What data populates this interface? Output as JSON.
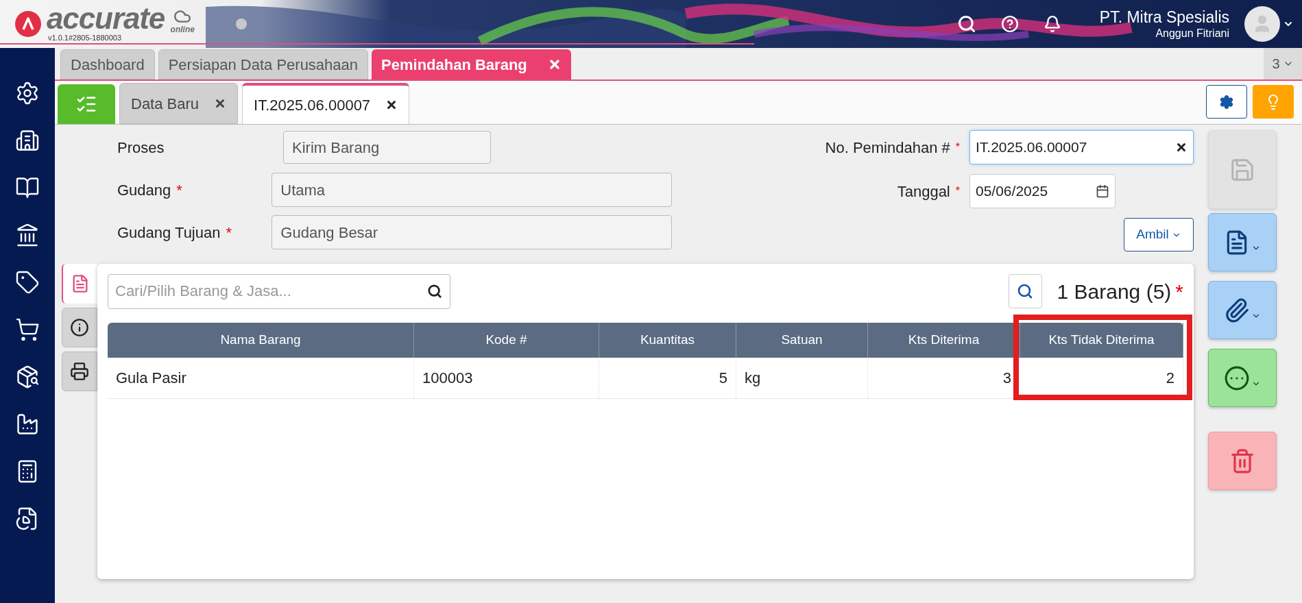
{
  "app": {
    "logo_text": "accurate",
    "logo_sub": "online",
    "version": "v1.0.1#2805-1880003"
  },
  "header": {
    "company": "PT. Mitra Spesialis",
    "user": "Anggun Fitriani"
  },
  "main_tabs": [
    {
      "label": "Dashboard",
      "selected": false,
      "closable": false
    },
    {
      "label": "Persiapan Data Perusahaan",
      "selected": false,
      "closable": false
    },
    {
      "label": "Pemindahan Barang",
      "selected": true,
      "closable": true
    }
  ],
  "tab_count": "3",
  "sub_tabs": [
    {
      "label": "Data Baru",
      "selected": false
    },
    {
      "label": "IT.2025.06.00007",
      "selected": true
    }
  ],
  "form": {
    "left": [
      {
        "label": "Proses",
        "value": "Kirim Barang"
      },
      {
        "label": "Gudang",
        "required_mark": "*",
        "value": "Utama"
      },
      {
        "label": "Gudang Tujuan",
        "required_mark": "*",
        "value": "Gudang Besar"
      }
    ],
    "number": {
      "label": "No. Pemindahan #",
      "required_mark": "*",
      "value": "IT.2025.06.00007"
    },
    "date": {
      "label": "Tanggal",
      "required_mark": "*",
      "value": "05/06/2025"
    },
    "fetch_button": "Ambil"
  },
  "side_tabs": [
    {
      "kind": "detail",
      "selected": true
    },
    {
      "kind": "info",
      "selected": false
    },
    {
      "kind": "print",
      "selected": false
    }
  ],
  "items": {
    "search_placeholder": "Cari/Pilih Barang & Jasa...",
    "count": "1 Barang (5)",
    "required_mark": "*",
    "columns": [
      {
        "label": "Nama Barang",
        "kind": "text",
        "highlighted": false
      },
      {
        "label": "Kode #",
        "kind": "text",
        "highlighted": false
      },
      {
        "label": "Kuantitas",
        "kind": "number",
        "highlighted": false
      },
      {
        "label": "Satuan",
        "kind": "text",
        "highlighted": false
      },
      {
        "label": "Kts Diterima",
        "kind": "number",
        "highlighted": false
      },
      {
        "label": "Kts Tidak Diterima",
        "kind": "number",
        "highlighted": true
      }
    ],
    "rows": [
      [
        "Gula Pasir",
        "100003",
        "5",
        "kg",
        "3",
        "2"
      ]
    ]
  },
  "actions": [
    {
      "kind": "save",
      "disabled": true
    },
    {
      "kind": "document",
      "disabled": false
    },
    {
      "kind": "attach",
      "disabled": false
    },
    {
      "kind": "more",
      "disabled": false
    },
    {
      "kind": "delete",
      "disabled": false
    }
  ]
}
